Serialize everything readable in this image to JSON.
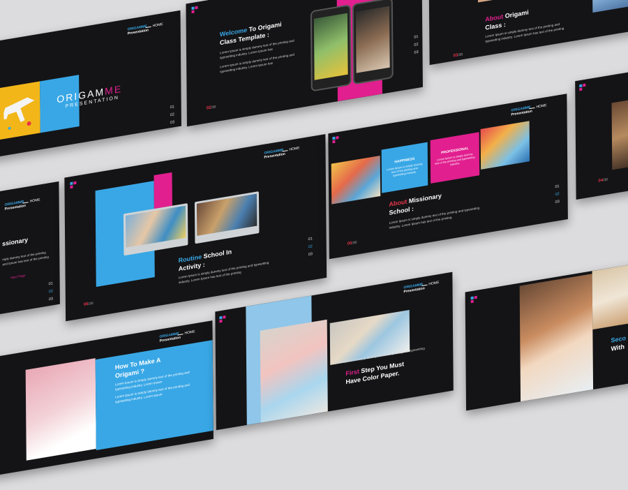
{
  "brand": {
    "line1": "ORIGAMME",
    "line2": "Presentation",
    "home": "HOME"
  },
  "lorem_short": "Lorem Ipsum is simply dummy text of the printing and typesetting industry. Lorem Ipsum has",
  "lorem_medium": "Lorem Ipsum is simply dummy text of the printing and typesetting industry. Lorem Ipsum has text of the printing",
  "colors": {
    "blue": "#39a7e6",
    "pink": "#e11f8f",
    "yellow": "#f2b619",
    "dark": "#141416"
  },
  "cover": {
    "title_a": "ORIGAM",
    "title_b": "ME",
    "subtitle": "PRESENTATION",
    "nums": [
      "01",
      "02",
      "03"
    ]
  },
  "welcome": {
    "h_a": "Welcome",
    "h_b": " To Origami",
    "h_c": "Class Template :",
    "body1": "Lorem Ipsum is simply dummy text of the printing and typesetting industry. Lorem Ipsum has",
    "body2": "Lorem Ipsum is simply dummy text of the printing and typesetting industry. Lorem Ipsum has",
    "page": "02",
    "total": "/30",
    "nums": [
      "01",
      "02",
      "03"
    ]
  },
  "about_class": {
    "h_a": "About",
    "h_b": " Origami",
    "h_c": "Class :",
    "body": "Lorem Ipsum is simply dummy text of the printing and typesetting industry. Lorem Ipsum has text of the printing",
    "page": "03",
    "total": "/30"
  },
  "missionary_left": {
    "heading": "ssionary",
    "body": "mply dummy text of the printing and Ipsum has text of the printing",
    "link": "Next Page",
    "nums": [
      "01",
      "02",
      "03"
    ]
  },
  "routine": {
    "h_a": "Routine",
    "h_b": " School In",
    "h_c": "Activity :",
    "body": "Lorem Ipsum is simply dummy text of the printing and typesetting industry. Lorem Ipsum has text of the printing",
    "page": "06",
    "total": "/30",
    "nums": [
      "01",
      "02",
      "03"
    ]
  },
  "missionary": {
    "h_a": "About",
    "h_b": " Missionary",
    "h_c": "School :",
    "happiness": "HAPPINESS",
    "professional": "PROFESSIONAL",
    "card_body": "Lorem Ipsum is simply dummy text of the printing and typesetting industry.",
    "body": "Lorem Ipsum is simply dummy text of the printing and typesetting industry. Lorem Ipsum has text of the printing",
    "page": "05",
    "total": "/30",
    "nums": [
      "01",
      "02",
      "03"
    ]
  },
  "right_mid": {
    "page": "04",
    "total": "/30"
  },
  "how_make": {
    "h_a": "How To Make A",
    "h_b": "Origami ?",
    "body1": "Lorem Ipsum is simply dummy text of the printing and typesetting industry. Lorem Ipsum",
    "body2": "Lorem Ipsum is simply dummy text of the printing and typesetting industry. Lorem Ipsum"
  },
  "first_step": {
    "h_a": "First",
    "h_b": " Step You Must",
    "h_c": "Have Color Paper.",
    "body": "Lorem Ipsum is simply dummy text of the printing and typesetting"
  },
  "second": {
    "h_a": "Seco",
    "h_b": "With"
  }
}
